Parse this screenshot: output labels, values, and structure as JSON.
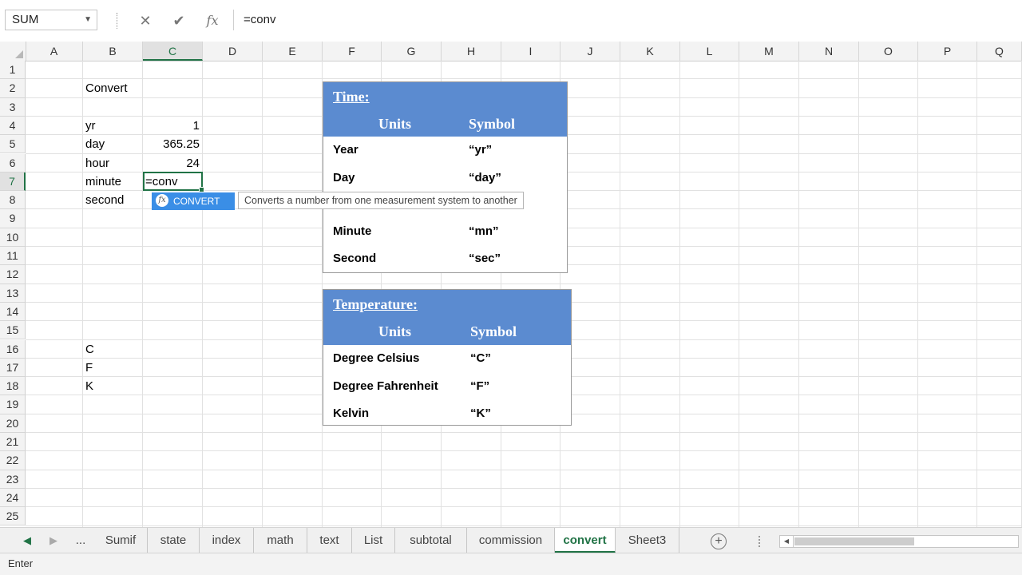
{
  "formula_bar": {
    "name_box": "SUM",
    "cancel_icon": "✕",
    "enter_icon": "✔",
    "fx_icon": "fx",
    "formula": "=conv"
  },
  "columns": [
    "A",
    "B",
    "C",
    "D",
    "E",
    "F",
    "G",
    "H",
    "I",
    "J",
    "K",
    "L",
    "M",
    "N",
    "O",
    "P",
    "Q"
  ],
  "rows": [
    "1",
    "2",
    "3",
    "4",
    "5",
    "6",
    "7",
    "8",
    "9",
    "10",
    "11",
    "12",
    "13",
    "14",
    "15",
    "16",
    "17",
    "18",
    "19",
    "20",
    "21",
    "22",
    "23",
    "24",
    "25"
  ],
  "cells": {
    "B2": "Convert",
    "B4": "yr",
    "C4": "1",
    "B5": "day",
    "C5": "365.25",
    "B6": "hour",
    "C6": "24",
    "B7": "minute",
    "C7": "=conv",
    "B8": "second",
    "B16": "C",
    "B17": "F",
    "B18": "K"
  },
  "autocomplete": {
    "item": "CONVERT",
    "icon": "fx",
    "tooltip": "Converts a number from one measurement system to another"
  },
  "time_table": {
    "title": "Time:",
    "col_units": "Units",
    "col_symbol": "Symbol",
    "rows": [
      {
        "unit": "Year",
        "symbol": "“yr”"
      },
      {
        "unit": "Day",
        "symbol": "“day”"
      },
      {
        "unit": "Minute",
        "symbol": "“mn”"
      },
      {
        "unit": "Second",
        "symbol": "“sec”"
      }
    ]
  },
  "temp_table": {
    "title": "Temperature:",
    "col_units": "Units",
    "col_symbol": "Symbol",
    "rows": [
      {
        "unit": "Degree Celsius",
        "symbol": "“C”"
      },
      {
        "unit": "Degree Fahrenheit",
        "symbol": "“F”"
      },
      {
        "unit": "Kelvin",
        "symbol": "“K”"
      }
    ]
  },
  "sheet_tabs": {
    "nav_prev": "◀",
    "nav_next": "▶",
    "more": "...",
    "tabs": [
      "Sumif",
      "state",
      "index",
      "math",
      "text",
      "List",
      "subtotal",
      "commission",
      "convert",
      "Sheet3"
    ],
    "active": "convert",
    "add_icon": "+"
  },
  "status_bar": {
    "mode": "Enter"
  },
  "colors": {
    "accent": "#217346",
    "table_header": "#5b8bd0",
    "autocomplete": "#3a8ee6"
  }
}
